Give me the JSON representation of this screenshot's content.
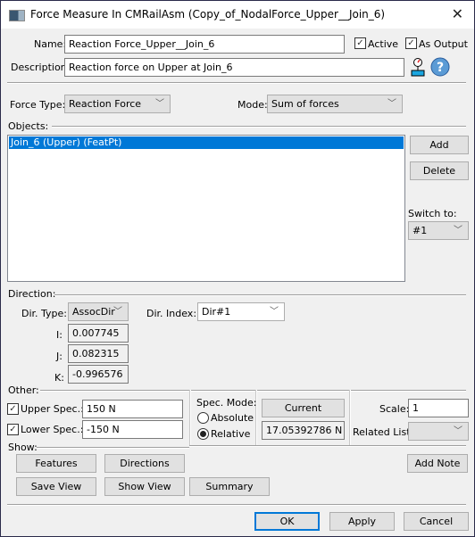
{
  "window": {
    "title": "Force Measure In CMRailAsm (Copy_of_NodalForce_Upper__Join_6)",
    "close_glyph": "✕"
  },
  "header": {
    "name_label": "Name:",
    "name_value": "Reaction Force_Upper__Join_6",
    "active_label": "Active",
    "active_checked": true,
    "as_output_label": "As Output",
    "as_output_checked": true,
    "description_label": "Description:",
    "description_value": "Reaction force on Upper at Join_6",
    "icons": [
      "measure-gauge-icon",
      "help-icon"
    ]
  },
  "force": {
    "force_type_label": "Force Type:",
    "force_type_value": "Reaction Force",
    "mode_label": "Mode:",
    "mode_value": "Sum of forces"
  },
  "objects": {
    "section_label": "Objects:",
    "items": [
      "Join_6 (Upper) (FeatPt)"
    ],
    "selected_index": 0,
    "add_label": "Add",
    "delete_label": "Delete",
    "switch_to_label": "Switch to:",
    "switch_to_value": "#1"
  },
  "direction": {
    "section_label": "Direction:",
    "dir_type_label": "Dir. Type:",
    "dir_type_value": "AssocDir",
    "dir_index_label": "Dir. Index:",
    "dir_index_value": "Dir#1",
    "i_label": "I:",
    "i_value": "0.007745",
    "j_label": "J:",
    "j_value": "0.082315",
    "k_label": "K:",
    "k_value": "-0.996576"
  },
  "other": {
    "section_label": "Other:",
    "upper_spec_label": "Upper Spec.:",
    "upper_spec_checked": true,
    "upper_spec_value": "150 N",
    "lower_spec_label": "Lower Spec.:",
    "lower_spec_checked": true,
    "lower_spec_value": "-150 N",
    "spec_mode_label": "Spec. Mode:",
    "absolute_label": "Absolute",
    "relative_label": "Relative",
    "spec_mode_selected": "Relative",
    "current_label": "Current",
    "current_value": "17.05392786 N",
    "scale_label": "Scale:",
    "scale_value": "1",
    "related_list_label": "Related List:",
    "related_list_value": ""
  },
  "show": {
    "section_label": "Show:",
    "features_label": "Features",
    "directions_label": "Directions",
    "add_note_label": "Add Note",
    "save_view_label": "Save View",
    "show_view_label": "Show View",
    "summary_label": "Summary"
  },
  "footer": {
    "ok_label": "OK",
    "apply_label": "Apply",
    "cancel_label": "Cancel"
  },
  "colors": {
    "selection": "#0078d7",
    "default_button_border": "#0078d7"
  }
}
